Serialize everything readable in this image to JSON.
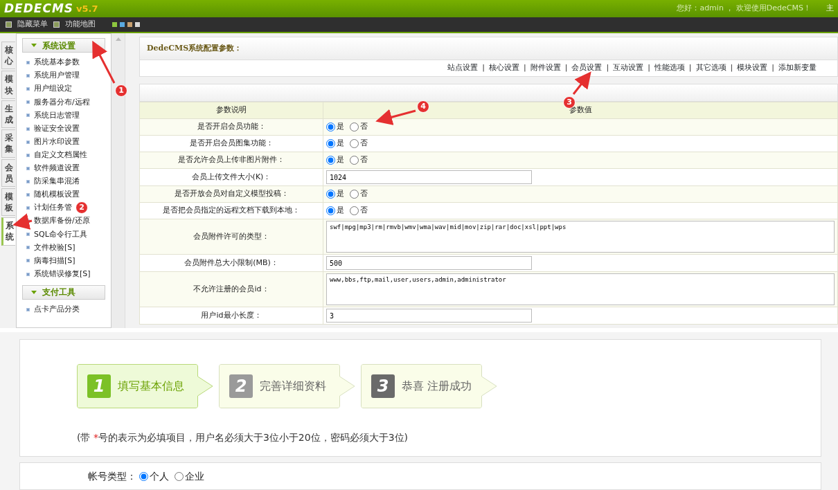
{
  "header": {
    "logo": "DEDECMS",
    "version": "v5.7",
    "greeting": "您好：admin ， 欢迎使用DedeCMS！",
    "menu_cut": "主"
  },
  "toolbar": {
    "items": [
      {
        "label": "隐藏菜单"
      },
      {
        "label": "功能地图"
      }
    ]
  },
  "side_tabs": [
    {
      "label": "核心",
      "selected": false
    },
    {
      "label": "模块",
      "selected": false
    },
    {
      "label": "生成",
      "selected": false
    },
    {
      "label": "采集",
      "selected": false
    },
    {
      "label": "会员",
      "selected": false
    },
    {
      "label": "模板",
      "selected": false
    },
    {
      "label": "系统",
      "selected": true
    }
  ],
  "sidebar": {
    "groups": [
      {
        "title": "系统设置",
        "items": [
          "系统基本参数",
          "系统用户管理",
          "用户组设定",
          "服务器分布/远程",
          "系统日志管理",
          "验证安全设置",
          "图片水印设置",
          "自定义文档属性",
          "软件频道设置",
          "防采集串混淆",
          "随机模板设置",
          "计划任务管",
          "数据库备份/还原",
          "SQL命令行工具",
          "文件校验[S]",
          "病毒扫描[S]",
          "系统错误修复[S]"
        ]
      },
      {
        "title": "支付工具",
        "items": [
          "点卡产品分类"
        ]
      }
    ]
  },
  "panel": {
    "title": "DedeCMS系统配置参数：",
    "links": [
      "站点设置",
      "核心设置",
      "附件设置",
      "会员设置",
      "互动设置",
      "性能选项",
      "其它选项",
      "模块设置",
      "添加新变量"
    ],
    "link_separators": [
      "|",
      "|",
      "|",
      "|",
      "|",
      "|",
      "|",
      "|"
    ],
    "columns": [
      "参数说明",
      "参数值"
    ],
    "rows": [
      {
        "label": "是否开启会员功能：",
        "kind": "radio",
        "options": [
          {
            "label": "是",
            "selected": true
          },
          {
            "label": "否",
            "selected": false
          }
        ]
      },
      {
        "label": "是否开启会员图集功能：",
        "kind": "radio",
        "options": [
          {
            "label": "是",
            "selected": true
          },
          {
            "label": "否",
            "selected": false
          }
        ]
      },
      {
        "label": "是否允许会员上传非图片附件：",
        "kind": "radio",
        "options": [
          {
            "label": "是",
            "selected": true
          },
          {
            "label": "否",
            "selected": false
          }
        ]
      },
      {
        "label": "会员上传文件大小(K)：",
        "kind": "text",
        "value": "1024"
      },
      {
        "label": "是否开放会员对自定义模型投稿：",
        "kind": "radio",
        "options": [
          {
            "label": "是",
            "selected": true
          },
          {
            "label": "否",
            "selected": false
          }
        ]
      },
      {
        "label": "是否把会员指定的远程文档下载到本地：",
        "kind": "radio",
        "options": [
          {
            "label": "是",
            "selected": true
          },
          {
            "label": "否",
            "selected": false
          }
        ]
      },
      {
        "label": "会员附件许可的类型：",
        "kind": "textarea",
        "value": "swf|mpg|mp3|rm|rmvb|wmv|wma|wav|mid|mov|zip|rar|doc|xsl|ppt|wps"
      },
      {
        "label": "会员附件总大小限制(MB)：",
        "kind": "text",
        "value": "500"
      },
      {
        "label": "不允许注册的会员id：",
        "kind": "textarea",
        "value": "www,bbs,ftp,mail,user,users,admin,administrator"
      },
      {
        "label": "用户id最小长度：",
        "kind": "text",
        "value": "3"
      }
    ]
  },
  "annotations": [
    "1",
    "2",
    "3",
    "4"
  ],
  "register": {
    "steps": [
      {
        "number": "1",
        "label": "填写基本信息",
        "selected": true
      },
      {
        "number": "2",
        "label": "完善详细资料",
        "selected": false
      },
      {
        "number": "3",
        "label": "恭喜  注册成功",
        "selected": false
      }
    ],
    "note": {
      "prefix": "(带 ",
      "required_mark": "*",
      "text": "号的表示为必填项目，用户名必须大于3位小于20位，密码必须大于3位)"
    },
    "account_type": {
      "label": "帐号类型：",
      "options": [
        {
          "label": "个人",
          "selected": true
        },
        {
          "label": "企业",
          "selected": false
        }
      ]
    }
  }
}
